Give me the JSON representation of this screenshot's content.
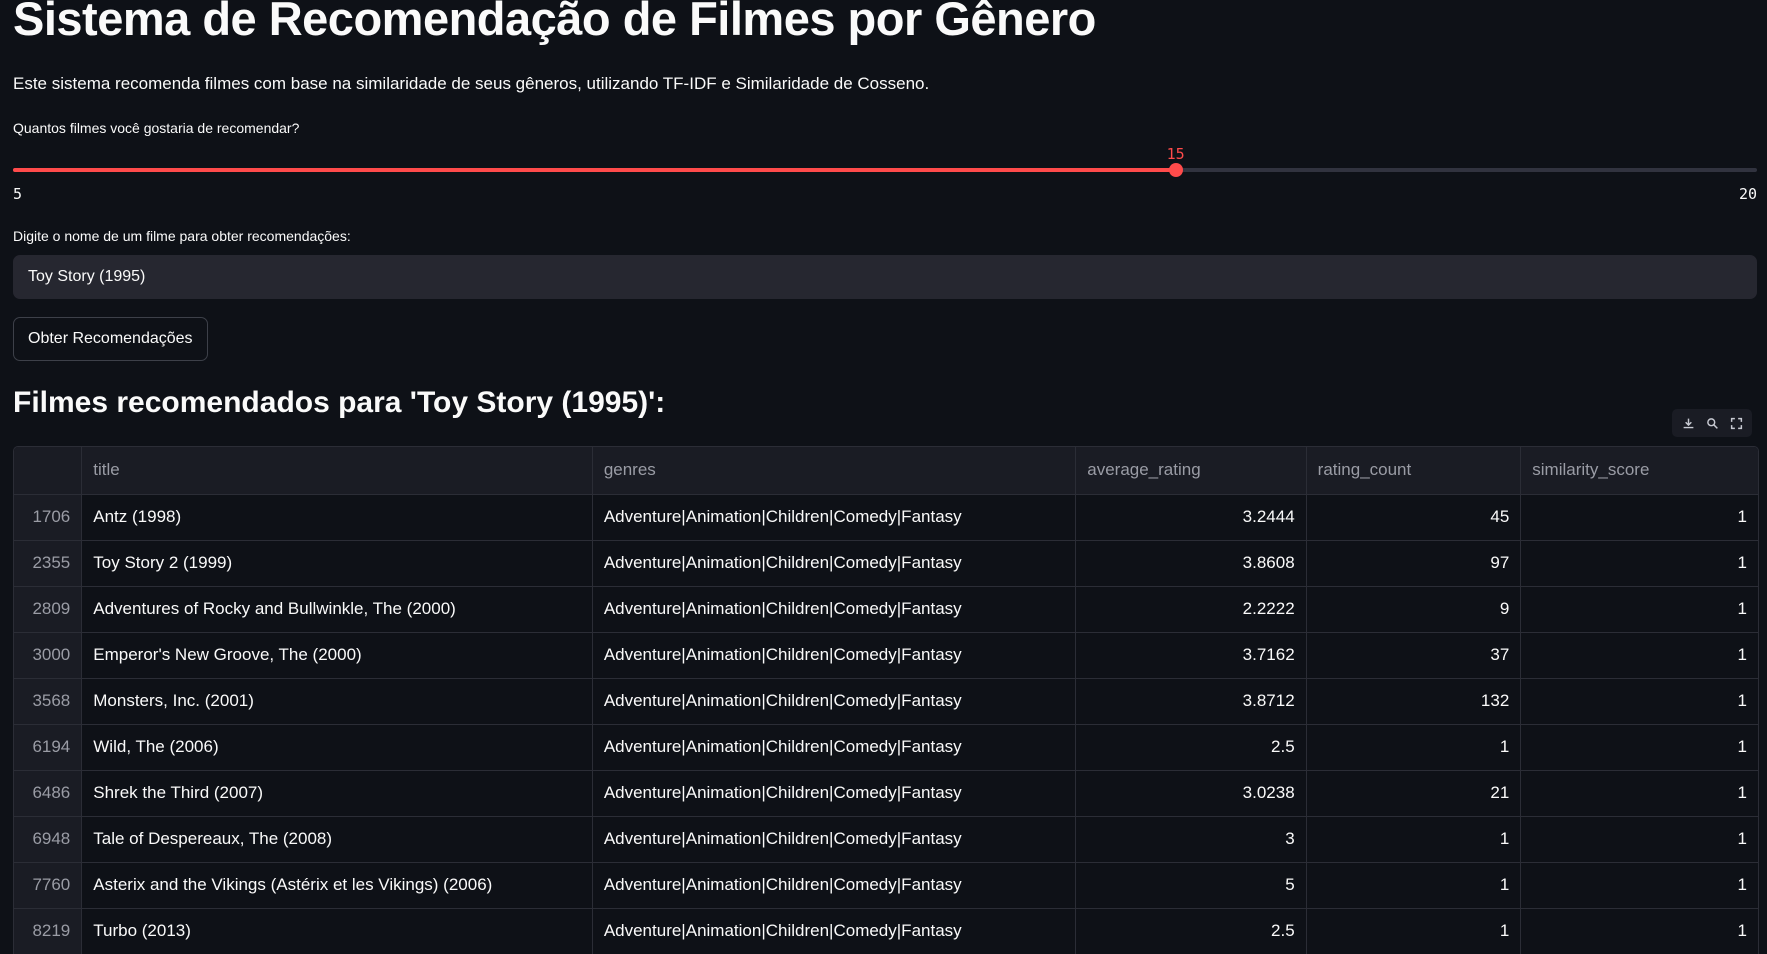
{
  "header": {
    "title": "Sistema de Recomendação de Filmes por Gênero",
    "description": "Este sistema recomenda filmes com base na similaridade de seus gêneros, utilizando TF-IDF e Similaridade de Cosseno."
  },
  "slider": {
    "label": "Quantos filmes você gostaria de recomendar?",
    "value": 15,
    "min": 5,
    "max": 20,
    "color": "#ff4b4b"
  },
  "search": {
    "label": "Digite o nome de um filme para obter recomendações:",
    "value": "Toy Story (1995)"
  },
  "button": {
    "label": "Obter Recomendações"
  },
  "results": {
    "heading": "Filmes recomendados para 'Toy Story (1995)':",
    "toolbar": [
      "download-icon",
      "search-icon",
      "fullscreen-icon"
    ],
    "columns": [
      "",
      "title",
      "genres",
      "average_rating",
      "rating_count",
      "similarity_score"
    ],
    "rows": [
      {
        "index": "1706",
        "title": "Antz (1998)",
        "genres": "Adventure|Animation|Children|Comedy|Fantasy",
        "average_rating": "3.2444",
        "rating_count": "45",
        "similarity_score": "1"
      },
      {
        "index": "2355",
        "title": "Toy Story 2 (1999)",
        "genres": "Adventure|Animation|Children|Comedy|Fantasy",
        "average_rating": "3.8608",
        "rating_count": "97",
        "similarity_score": "1"
      },
      {
        "index": "2809",
        "title": "Adventures of Rocky and Bullwinkle, The (2000)",
        "genres": "Adventure|Animation|Children|Comedy|Fantasy",
        "average_rating": "2.2222",
        "rating_count": "9",
        "similarity_score": "1"
      },
      {
        "index": "3000",
        "title": "Emperor's New Groove, The (2000)",
        "genres": "Adventure|Animation|Children|Comedy|Fantasy",
        "average_rating": "3.7162",
        "rating_count": "37",
        "similarity_score": "1"
      },
      {
        "index": "3568",
        "title": "Monsters, Inc. (2001)",
        "genres": "Adventure|Animation|Children|Comedy|Fantasy",
        "average_rating": "3.8712",
        "rating_count": "132",
        "similarity_score": "1"
      },
      {
        "index": "6194",
        "title": "Wild, The (2006)",
        "genres": "Adventure|Animation|Children|Comedy|Fantasy",
        "average_rating": "2.5",
        "rating_count": "1",
        "similarity_score": "1"
      },
      {
        "index": "6486",
        "title": "Shrek the Third (2007)",
        "genres": "Adventure|Animation|Children|Comedy|Fantasy",
        "average_rating": "3.0238",
        "rating_count": "21",
        "similarity_score": "1"
      },
      {
        "index": "6948",
        "title": "Tale of Despereaux, The (2008)",
        "genres": "Adventure|Animation|Children|Comedy|Fantasy",
        "average_rating": "3",
        "rating_count": "1",
        "similarity_score": "1"
      },
      {
        "index": "7760",
        "title": "Asterix and the Vikings (Astérix et les Vikings) (2006)",
        "genres": "Adventure|Animation|Children|Comedy|Fantasy",
        "average_rating": "5",
        "rating_count": "1",
        "similarity_score": "1"
      },
      {
        "index": "8219",
        "title": "Turbo (2013)",
        "genres": "Adventure|Animation|Children|Comedy|Fantasy",
        "average_rating": "2.5",
        "rating_count": "1",
        "similarity_score": "1"
      }
    ]
  }
}
